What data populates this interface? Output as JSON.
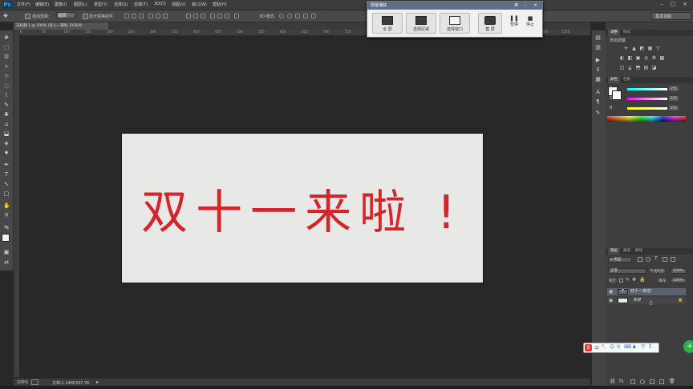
{
  "app": {
    "logo": "Ps"
  },
  "menu": [
    "文件(F)",
    "编辑(E)",
    "图像(I)",
    "图层(L)",
    "类型(Y)",
    "选择(S)",
    "滤镜(T)",
    "3D(D)",
    "视图(V)",
    "窗口(W)",
    "帮助(H)"
  ],
  "window_controls": [
    "–",
    "□",
    "×"
  ],
  "options_bar": {
    "auto_select_label": "自动选择:",
    "auto_select_value": "图层",
    "show_transform_label": "显示变换控件",
    "mode_3d_label": "3D 模式:",
    "workspace": "基本功能"
  },
  "tools": [
    "✥",
    "⬚",
    "ʘ",
    "⌖",
    "⊹",
    "◌",
    "⌇",
    "✎",
    "♣",
    "⌂",
    "⬓",
    "◈",
    "♦",
    "✒",
    "T",
    "↖",
    "□",
    "✋",
    "⚲",
    "⇆",
    "▣",
    "⇄",
    "⬜"
  ],
  "document": {
    "tab_title": "未标题-1 @ 100% (双十一来啦, RGB/8)",
    "ruler_ticks": [
      "0",
      "50",
      "100",
      "150",
      "200",
      "250",
      "300",
      "350",
      "400",
      "450",
      "500",
      "550",
      "600",
      "650",
      "700",
      "750",
      "800",
      "850",
      "900",
      "950",
      "1000",
      "1050",
      "1100",
      "1150",
      "1200",
      "1250"
    ],
    "canvas_text": "双十一来啦 !",
    "canvas_text_color": "#d4262a"
  },
  "status_bar": {
    "zoom": "100%",
    "doc_info": "文档:1.14M/347.7K"
  },
  "capture_tool": {
    "title": "屏幕捕获",
    "buttons": [
      "全 屏",
      "选择区域",
      "选择窗口",
      "截 屏",
      "暂停",
      "停止"
    ]
  },
  "right_panel": {
    "adjust_tabs": [
      "调整",
      "样式"
    ],
    "adjust_title": "添加调整",
    "adjust_icons": [
      "☀",
      "▲",
      "◩",
      "▦",
      "▽",
      "◐",
      "◧",
      "▣",
      "◎",
      "♻",
      "▩",
      "◫",
      "◭",
      "⬒",
      "▤",
      "◪",
      "▨",
      "◮",
      "◯",
      "▥"
    ],
    "color_tabs": [
      "颜色",
      "色板"
    ],
    "sliders": [
      {
        "label": "R",
        "value": "255",
        "color": "#e04c4c"
      },
      {
        "label": "G",
        "value": "255",
        "color": "#4ccf4c"
      },
      {
        "label": "B",
        "value": "255",
        "color": "#d8d84c"
      }
    ],
    "layers_tabs": [
      "图层",
      "通道",
      "路径"
    ],
    "filter_kind": "ρ 类型",
    "blend_mode": "正常",
    "opacity_label": "不透明度:",
    "opacity_value": "100%",
    "lock_label": "锁定:",
    "fill_label": "填充:",
    "fill_value": "100%",
    "layers": [
      {
        "name": "双十一来啦!",
        "type": "text",
        "selected": true
      },
      {
        "name": "背景",
        "type": "background",
        "selected": false
      }
    ]
  },
  "ime": {
    "logo": "S",
    "items": [
      "中",
      "°,",
      "☺",
      "⚲",
      "⌨",
      "♟",
      "👕",
      "⁑"
    ]
  },
  "green_button": "+"
}
